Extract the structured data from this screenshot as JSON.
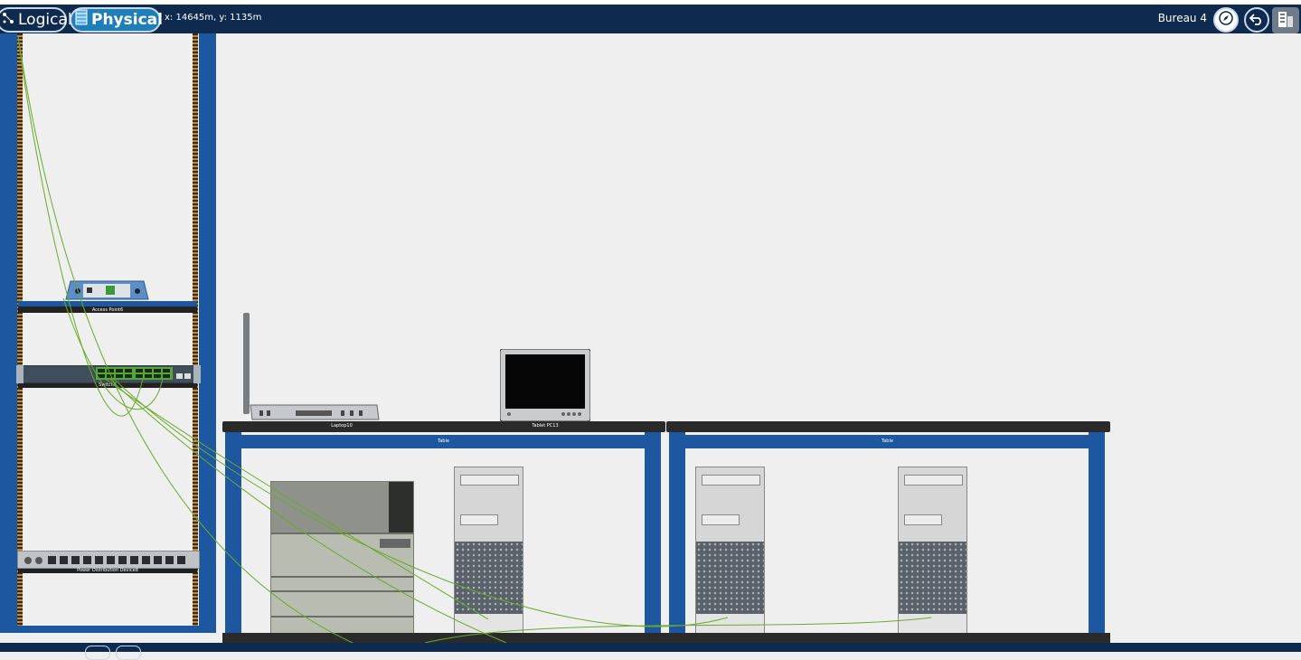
{
  "toolbar": {
    "logical_label": "Logical",
    "physical_label": "Physical",
    "coordinates": "x: 14645m, y: 1135m",
    "location": "Bureau 4"
  },
  "rack": {
    "devices": [
      {
        "label": "Access Point6"
      },
      {
        "label": "Switch8"
      },
      {
        "label": "Power Distribution Device8"
      }
    ]
  },
  "workspace": {
    "table_devices": [
      {
        "label": "Laptop10"
      },
      {
        "label": "Tablet PC13"
      }
    ],
    "tables": [
      {
        "label": "Table"
      },
      {
        "label": "Table"
      }
    ]
  },
  "colors": {
    "topbar": "#0f2a4f",
    "physical_active": "#1e7fb8",
    "rack_blue": "#1c57a0",
    "cable_green": "#6aaa2a",
    "canvas": "#efeff0"
  }
}
